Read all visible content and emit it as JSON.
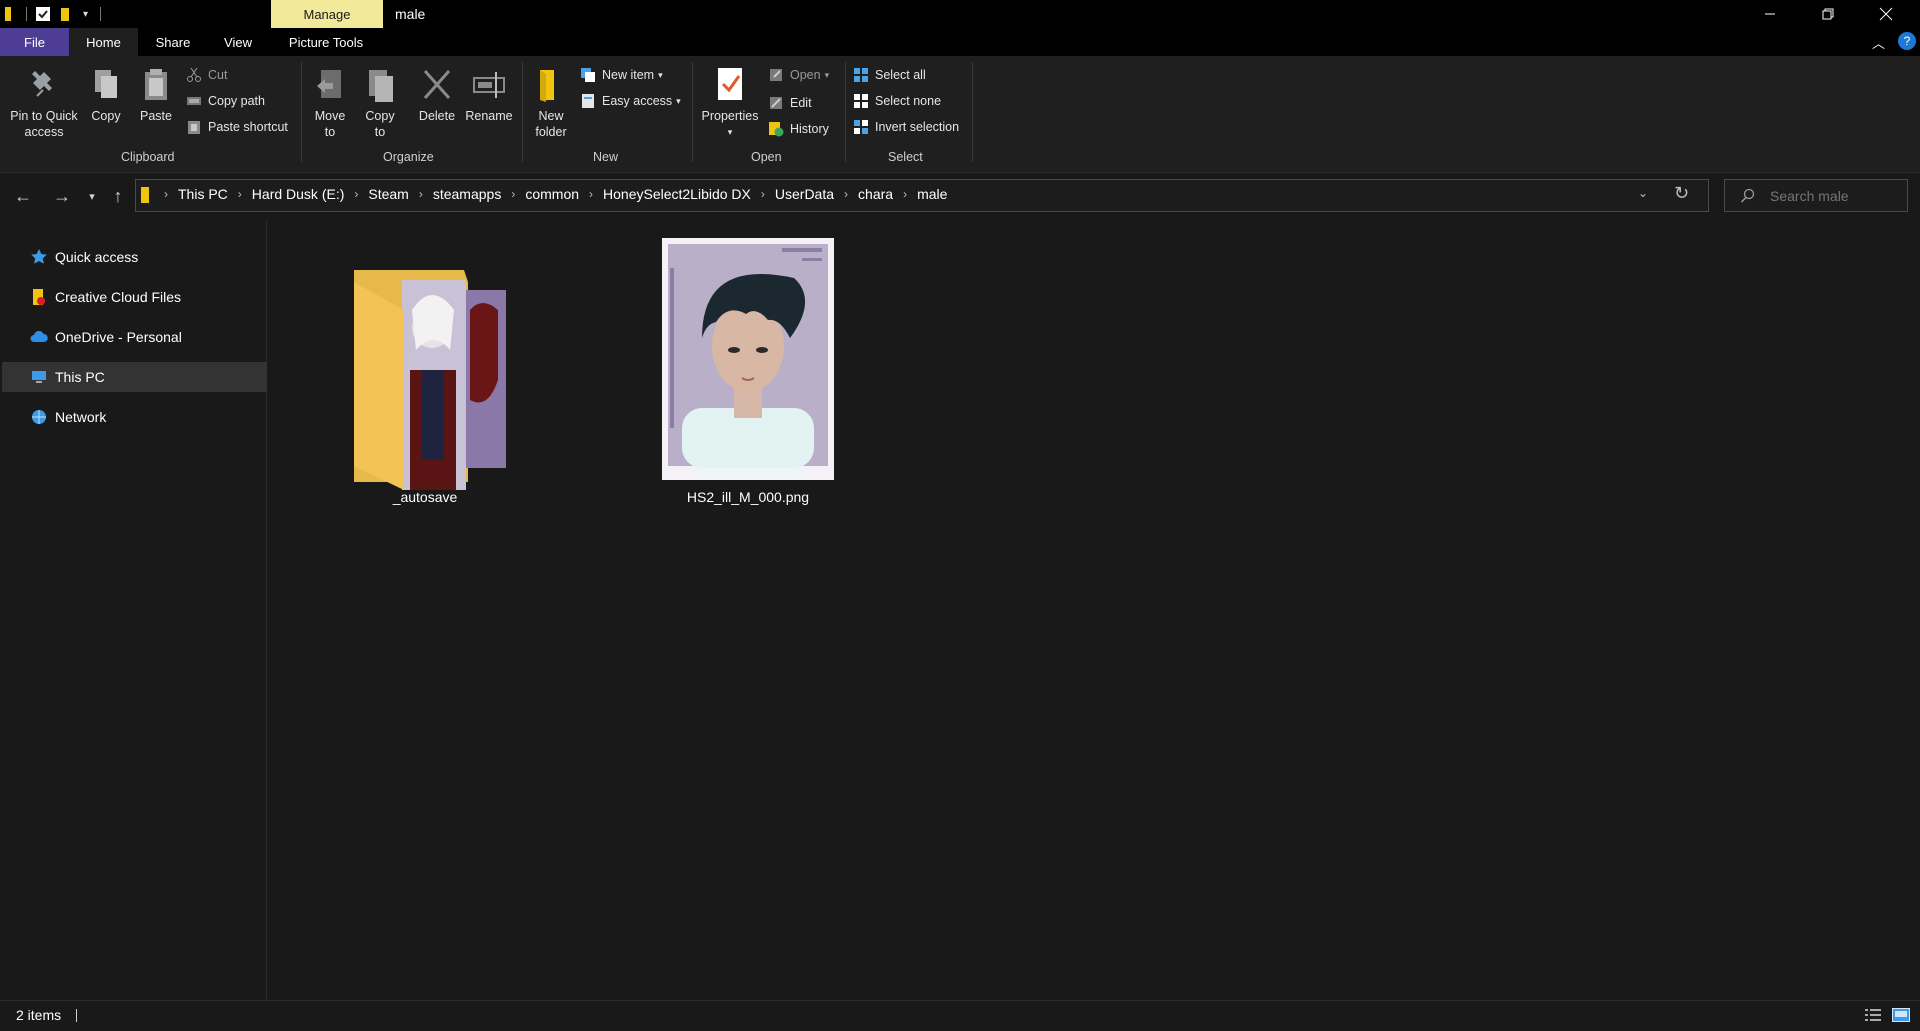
{
  "titlebar": {
    "manage_label": "Manage",
    "window_title": "male",
    "minimize_icon": "minimize-icon",
    "restore_icon": "restore-icon",
    "close_icon": "close-icon"
  },
  "tabs": {
    "file": "File",
    "home": "Home",
    "share": "Share",
    "view": "View",
    "picture_tools": "Picture Tools"
  },
  "ribbon": {
    "clipboard": {
      "pin": "Pin to Quick access",
      "copy": "Copy",
      "paste": "Paste",
      "cut": "Cut",
      "copy_path": "Copy path",
      "paste_shortcut": "Paste shortcut",
      "label": "Clipboard"
    },
    "organize": {
      "move_to": "Move to",
      "copy_to": "Copy to",
      "delete": "Delete",
      "rename": "Rename",
      "label": "Organize"
    },
    "new": {
      "new_folder": "New folder",
      "new_item": "New item",
      "easy_access": "Easy access",
      "label": "New"
    },
    "open": {
      "properties": "Properties",
      "open": "Open",
      "edit": "Edit",
      "history": "History",
      "label": "Open"
    },
    "select": {
      "select_all": "Select all",
      "select_none": "Select none",
      "invert_selection": "Invert selection",
      "label": "Select"
    }
  },
  "address": {
    "crumbs": [
      "This PC",
      "Hard Dusk (E:)",
      "Steam",
      "steamapps",
      "common",
      "HoneySelect2Libido DX",
      "UserData",
      "chara",
      "male"
    ]
  },
  "search": {
    "placeholder": "Search male"
  },
  "sidebar": {
    "items": [
      {
        "label": "Quick access",
        "icon": "star-icon"
      },
      {
        "label": "Creative Cloud Files",
        "icon": "creative-cloud-icon"
      },
      {
        "label": "OneDrive - Personal",
        "icon": "cloud-icon"
      },
      {
        "label": "This PC",
        "icon": "computer-icon"
      },
      {
        "label": "Network",
        "icon": "network-icon"
      }
    ]
  },
  "files": [
    {
      "name": "_autosave",
      "type": "folder"
    },
    {
      "name": "HS2_ill_M_000.png",
      "type": "image"
    }
  ],
  "status": {
    "count": "2 items"
  },
  "colors": {
    "file_tab": "#4d3d95",
    "manage_tab": "#f3e99a",
    "background": "#191919",
    "ribbon": "#1f1f1f"
  }
}
